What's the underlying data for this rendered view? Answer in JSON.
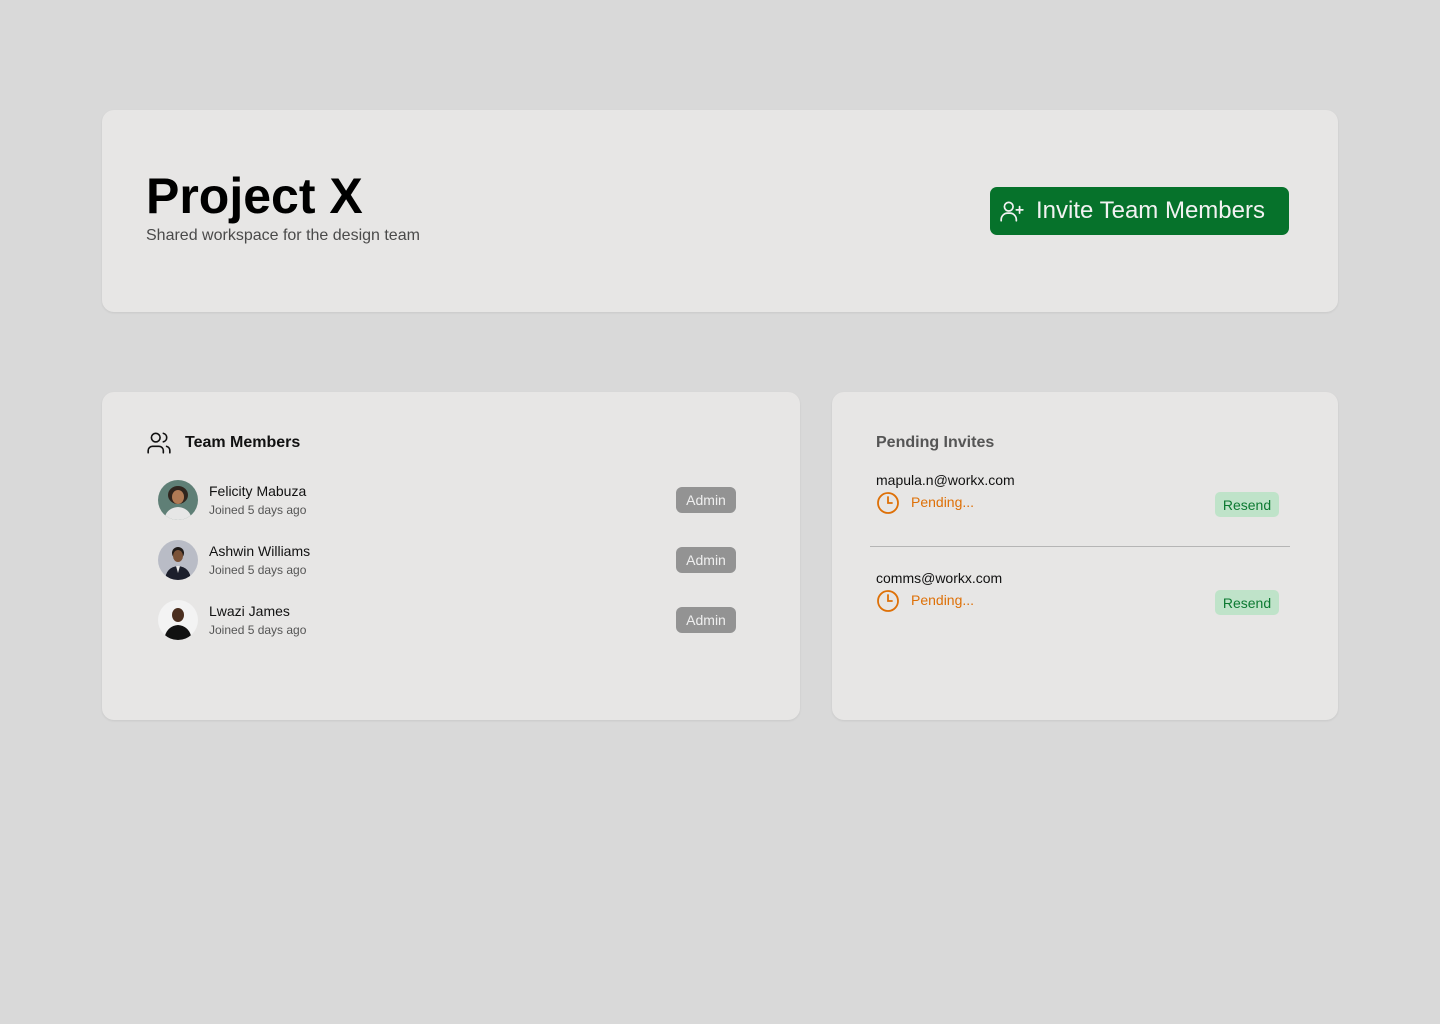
{
  "header": {
    "title": "Project X",
    "subtitle": "Shared workspace for the design team",
    "invite_button_label": "Invite Team Members",
    "invite_button_icon": "user-plus-icon"
  },
  "team_members": {
    "title": "Team Members",
    "icon": "users-icon",
    "members": [
      {
        "name": "Felicity Mabuza",
        "joined": "Joined 5 days ago",
        "role": "Admin"
      },
      {
        "name": "Ashwin Williams",
        "joined": "Joined 5 days ago",
        "role": "Admin"
      },
      {
        "name": "Lwazi James",
        "joined": "Joined 5 days ago",
        "role": "Admin"
      }
    ]
  },
  "pending_invites": {
    "title": "Pending Invites",
    "invites": [
      {
        "email": "mapula.n@workx.com",
        "status": "Pending...",
        "action_label": "Resend"
      },
      {
        "email": "comms@workx.com",
        "status": "Pending...",
        "action_label": "Resend"
      }
    ]
  },
  "colors": {
    "page_background": "#d9d9d9",
    "card_background": "#e7e6e5",
    "primary_button": "#06722b",
    "role_badge": "#939393",
    "pending_status": "#de7007",
    "resend_background": "#bfe3c9",
    "resend_text": "#0d7a32"
  }
}
